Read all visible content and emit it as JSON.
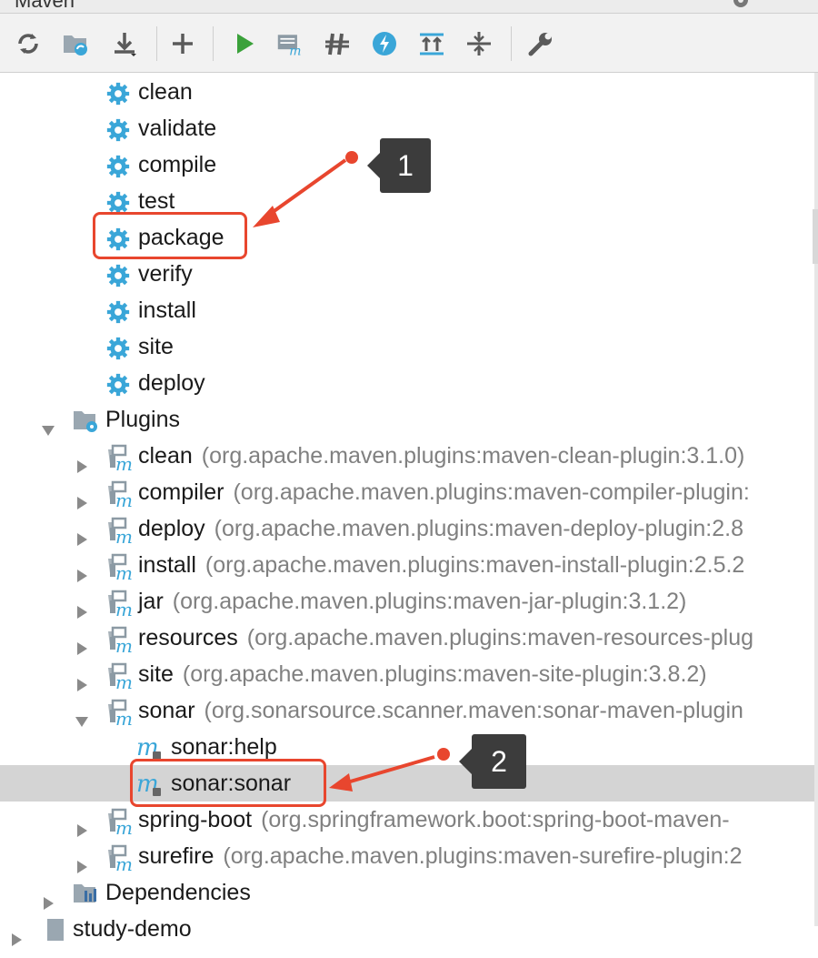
{
  "window": {
    "title": "Maven"
  },
  "toolbar": {
    "buttons": [
      {
        "name": "reimport-icon"
      },
      {
        "name": "generate-sources-icon"
      },
      {
        "name": "download-sources-icon"
      },
      {
        "name": "add-project-icon"
      },
      {
        "name": "run-icon"
      },
      {
        "name": "execute-goal-icon"
      },
      {
        "name": "toggle-offline-icon"
      },
      {
        "name": "skip-tests-icon"
      },
      {
        "name": "show-dependencies-icon"
      },
      {
        "name": "collapse-all-icon"
      },
      {
        "name": "settings-wrench-icon"
      }
    ]
  },
  "tree": {
    "lifecycle": [
      "clean",
      "validate",
      "compile",
      "test",
      "package",
      "verify",
      "install",
      "site",
      "deploy"
    ],
    "plugins_label": "Plugins",
    "plugins": [
      {
        "name": "clean",
        "coords": "(org.apache.maven.plugins:maven-clean-plugin:3.1.0)"
      },
      {
        "name": "compiler",
        "coords": "(org.apache.maven.plugins:maven-compiler-plugin:"
      },
      {
        "name": "deploy",
        "coords": "(org.apache.maven.plugins:maven-deploy-plugin:2.8"
      },
      {
        "name": "install",
        "coords": "(org.apache.maven.plugins:maven-install-plugin:2.5.2"
      },
      {
        "name": "jar",
        "coords": "(org.apache.maven.plugins:maven-jar-plugin:3.1.2)"
      },
      {
        "name": "resources",
        "coords": "(org.apache.maven.plugins:maven-resources-plug"
      },
      {
        "name": "site",
        "coords": "(org.apache.maven.plugins:maven-site-plugin:3.8.2)"
      },
      {
        "name": "sonar",
        "coords": "(org.sonarsource.scanner.maven:sonar-maven-plugin"
      },
      {
        "name": "spring-boot",
        "coords": "(org.springframework.boot:spring-boot-maven-"
      },
      {
        "name": "surefire",
        "coords": "(org.apache.maven.plugins:maven-surefire-plugin:2"
      }
    ],
    "sonar_goals": [
      "sonar:help",
      "sonar:sonar"
    ],
    "dependencies_label": "Dependencies",
    "next_project": "study-demo"
  },
  "annotations": {
    "badge1": "1",
    "badge2": "2",
    "accent_color": "#e8462e",
    "badge_color": "#3c3c3c"
  }
}
